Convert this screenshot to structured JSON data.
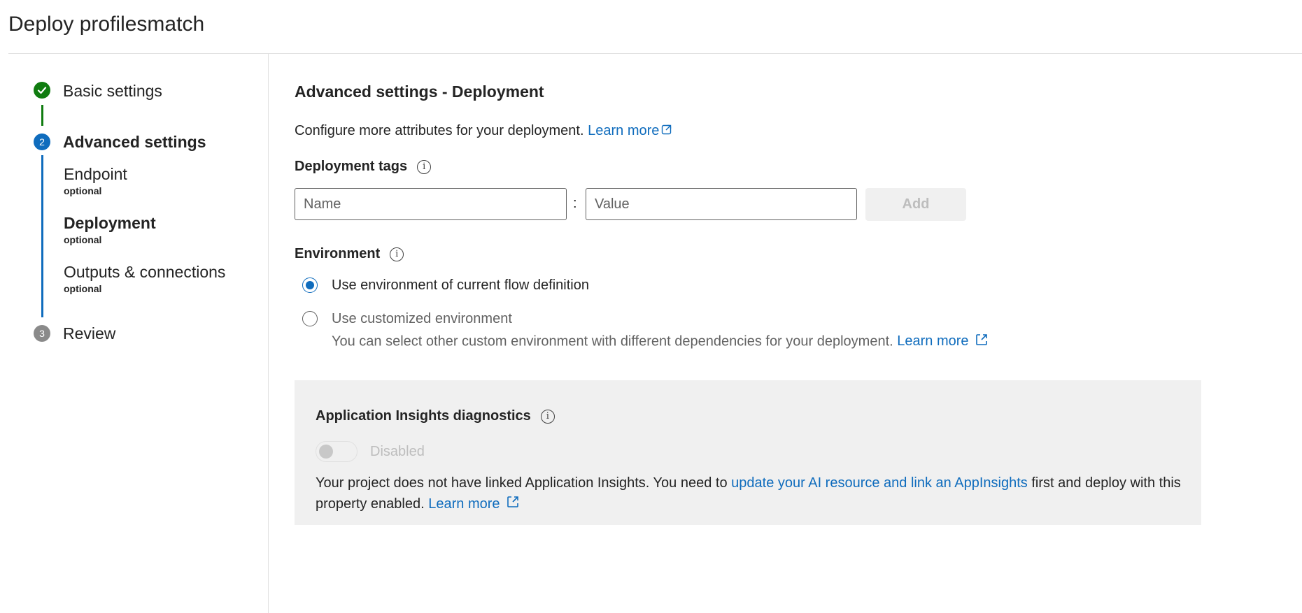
{
  "page": {
    "title": "Deploy profilesmatch"
  },
  "stepper": {
    "steps": [
      {
        "number": "",
        "label": "Basic settings",
        "status": "completed"
      },
      {
        "number": "2",
        "label": "Advanced settings",
        "status": "current"
      },
      {
        "number": "3",
        "label": "Review",
        "status": "pending"
      }
    ],
    "substeps": [
      {
        "label": "Endpoint",
        "note": "optional"
      },
      {
        "label": "Deployment",
        "note": "optional"
      },
      {
        "label": "Outputs & connections",
        "note": "optional"
      }
    ]
  },
  "main": {
    "title": "Advanced settings - Deployment",
    "description": "Configure more attributes for your deployment.",
    "learn_more": "Learn more",
    "tags": {
      "label": "Deployment tags",
      "name_placeholder": "Name",
      "name_value": "",
      "separator": ":",
      "value_placeholder": "Value",
      "value_value": "",
      "add_label": "Add"
    },
    "environment": {
      "label": "Environment",
      "options": [
        {
          "label": "Use environment of current flow definition",
          "selected": true
        },
        {
          "label": "Use customized environment",
          "selected": false
        }
      ],
      "custom_hint": "You can select other custom environment with different dependencies for your deployment.",
      "custom_learn_more": "Learn more"
    },
    "insights": {
      "title": "Application Insights diagnostics",
      "toggle_label": "Disabled",
      "toggle_on": false,
      "text_before": "Your project does not have linked Application Insights. You need to ",
      "link_text": "update your AI resource and link an AppInsights",
      "text_after": " first and deploy with this property enabled. ",
      "learn_more": "Learn more"
    }
  },
  "colors": {
    "accent": "#0f6cbd",
    "success": "#107c10",
    "pending": "#8a8a8a",
    "panel": "#f0f0f0"
  },
  "icons": [
    "checkmark-icon",
    "info-icon",
    "external-link-icon"
  ]
}
